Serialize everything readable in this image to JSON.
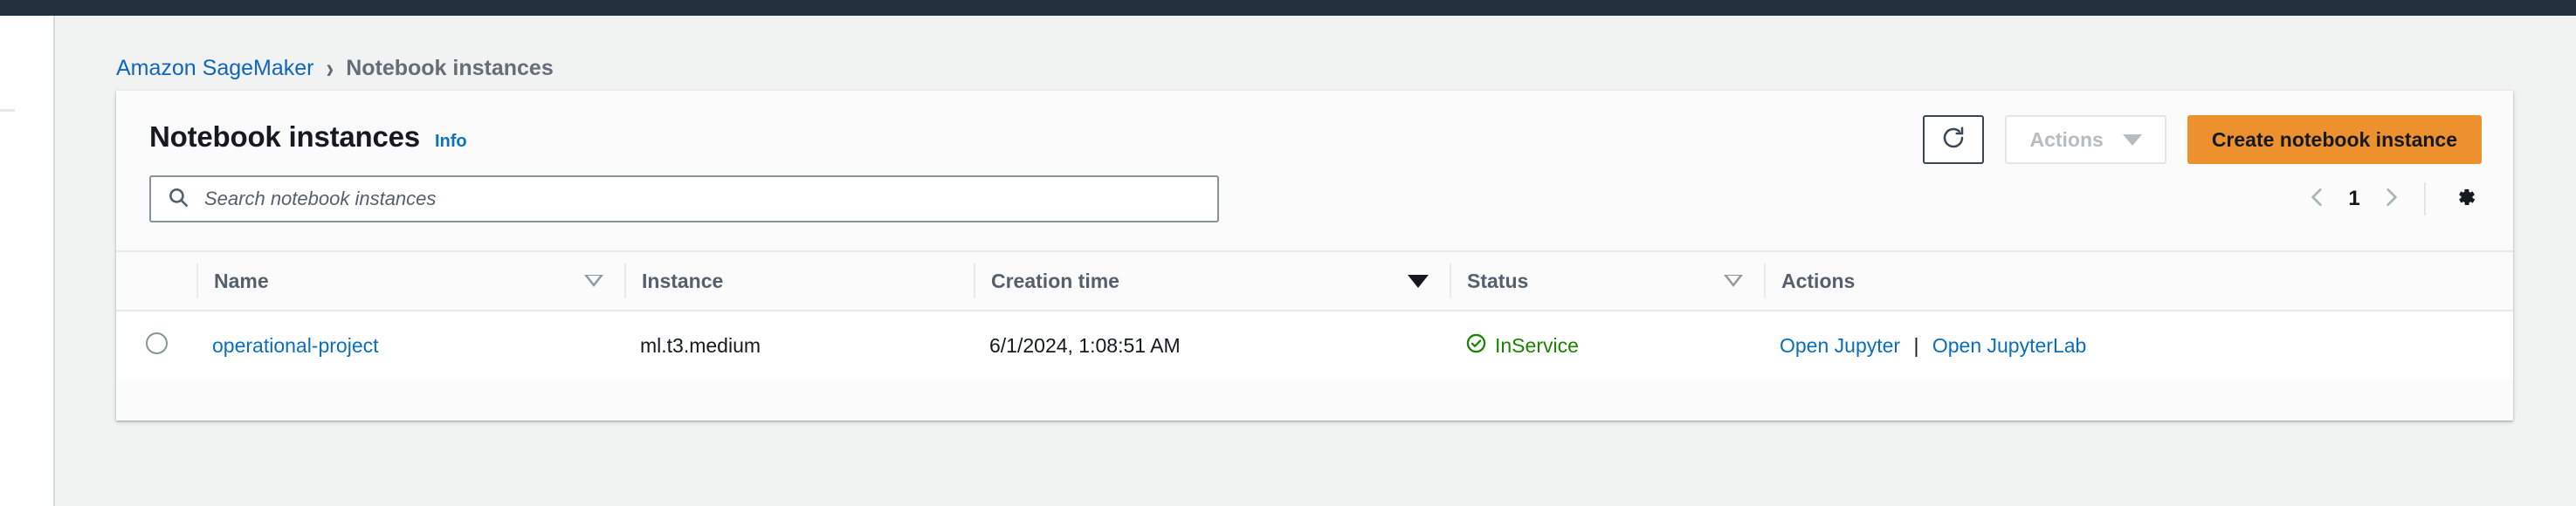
{
  "breadcrumb": {
    "root": "Amazon SageMaker",
    "separator": "›",
    "current": "Notebook instances"
  },
  "card": {
    "title": "Notebook instances",
    "info_label": "Info",
    "refresh_icon": "refresh-icon",
    "actions_label": "Actions",
    "actions_disabled": true,
    "create_label": "Create notebook instance",
    "create_color": "#ec912d"
  },
  "search": {
    "placeholder": "Search notebook instances",
    "value": "",
    "icon": "search-icon"
  },
  "pagination": {
    "prev_icon": "chevron-left-icon",
    "page": "1",
    "next_icon": "chevron-right-icon",
    "settings_icon": "gear-icon"
  },
  "table": {
    "columns": [
      {
        "label": "Name",
        "sort": "none"
      },
      {
        "label": "Instance",
        "sort": "none"
      },
      {
        "label": "Creation time",
        "sort": "desc"
      },
      {
        "label": "Status",
        "sort": "none"
      },
      {
        "label": "Actions",
        "sort": ""
      }
    ],
    "rows": [
      {
        "selected": false,
        "name": "operational-project",
        "instance": "ml.t3.medium",
        "creation_time": "6/1/2024, 1:08:51 AM",
        "status": "InService",
        "status_color": "#1d8102",
        "status_icon": "check-circle-icon",
        "action_primary": "Open Jupyter",
        "action_separator": "|",
        "action_secondary": "Open JupyterLab"
      }
    ]
  }
}
